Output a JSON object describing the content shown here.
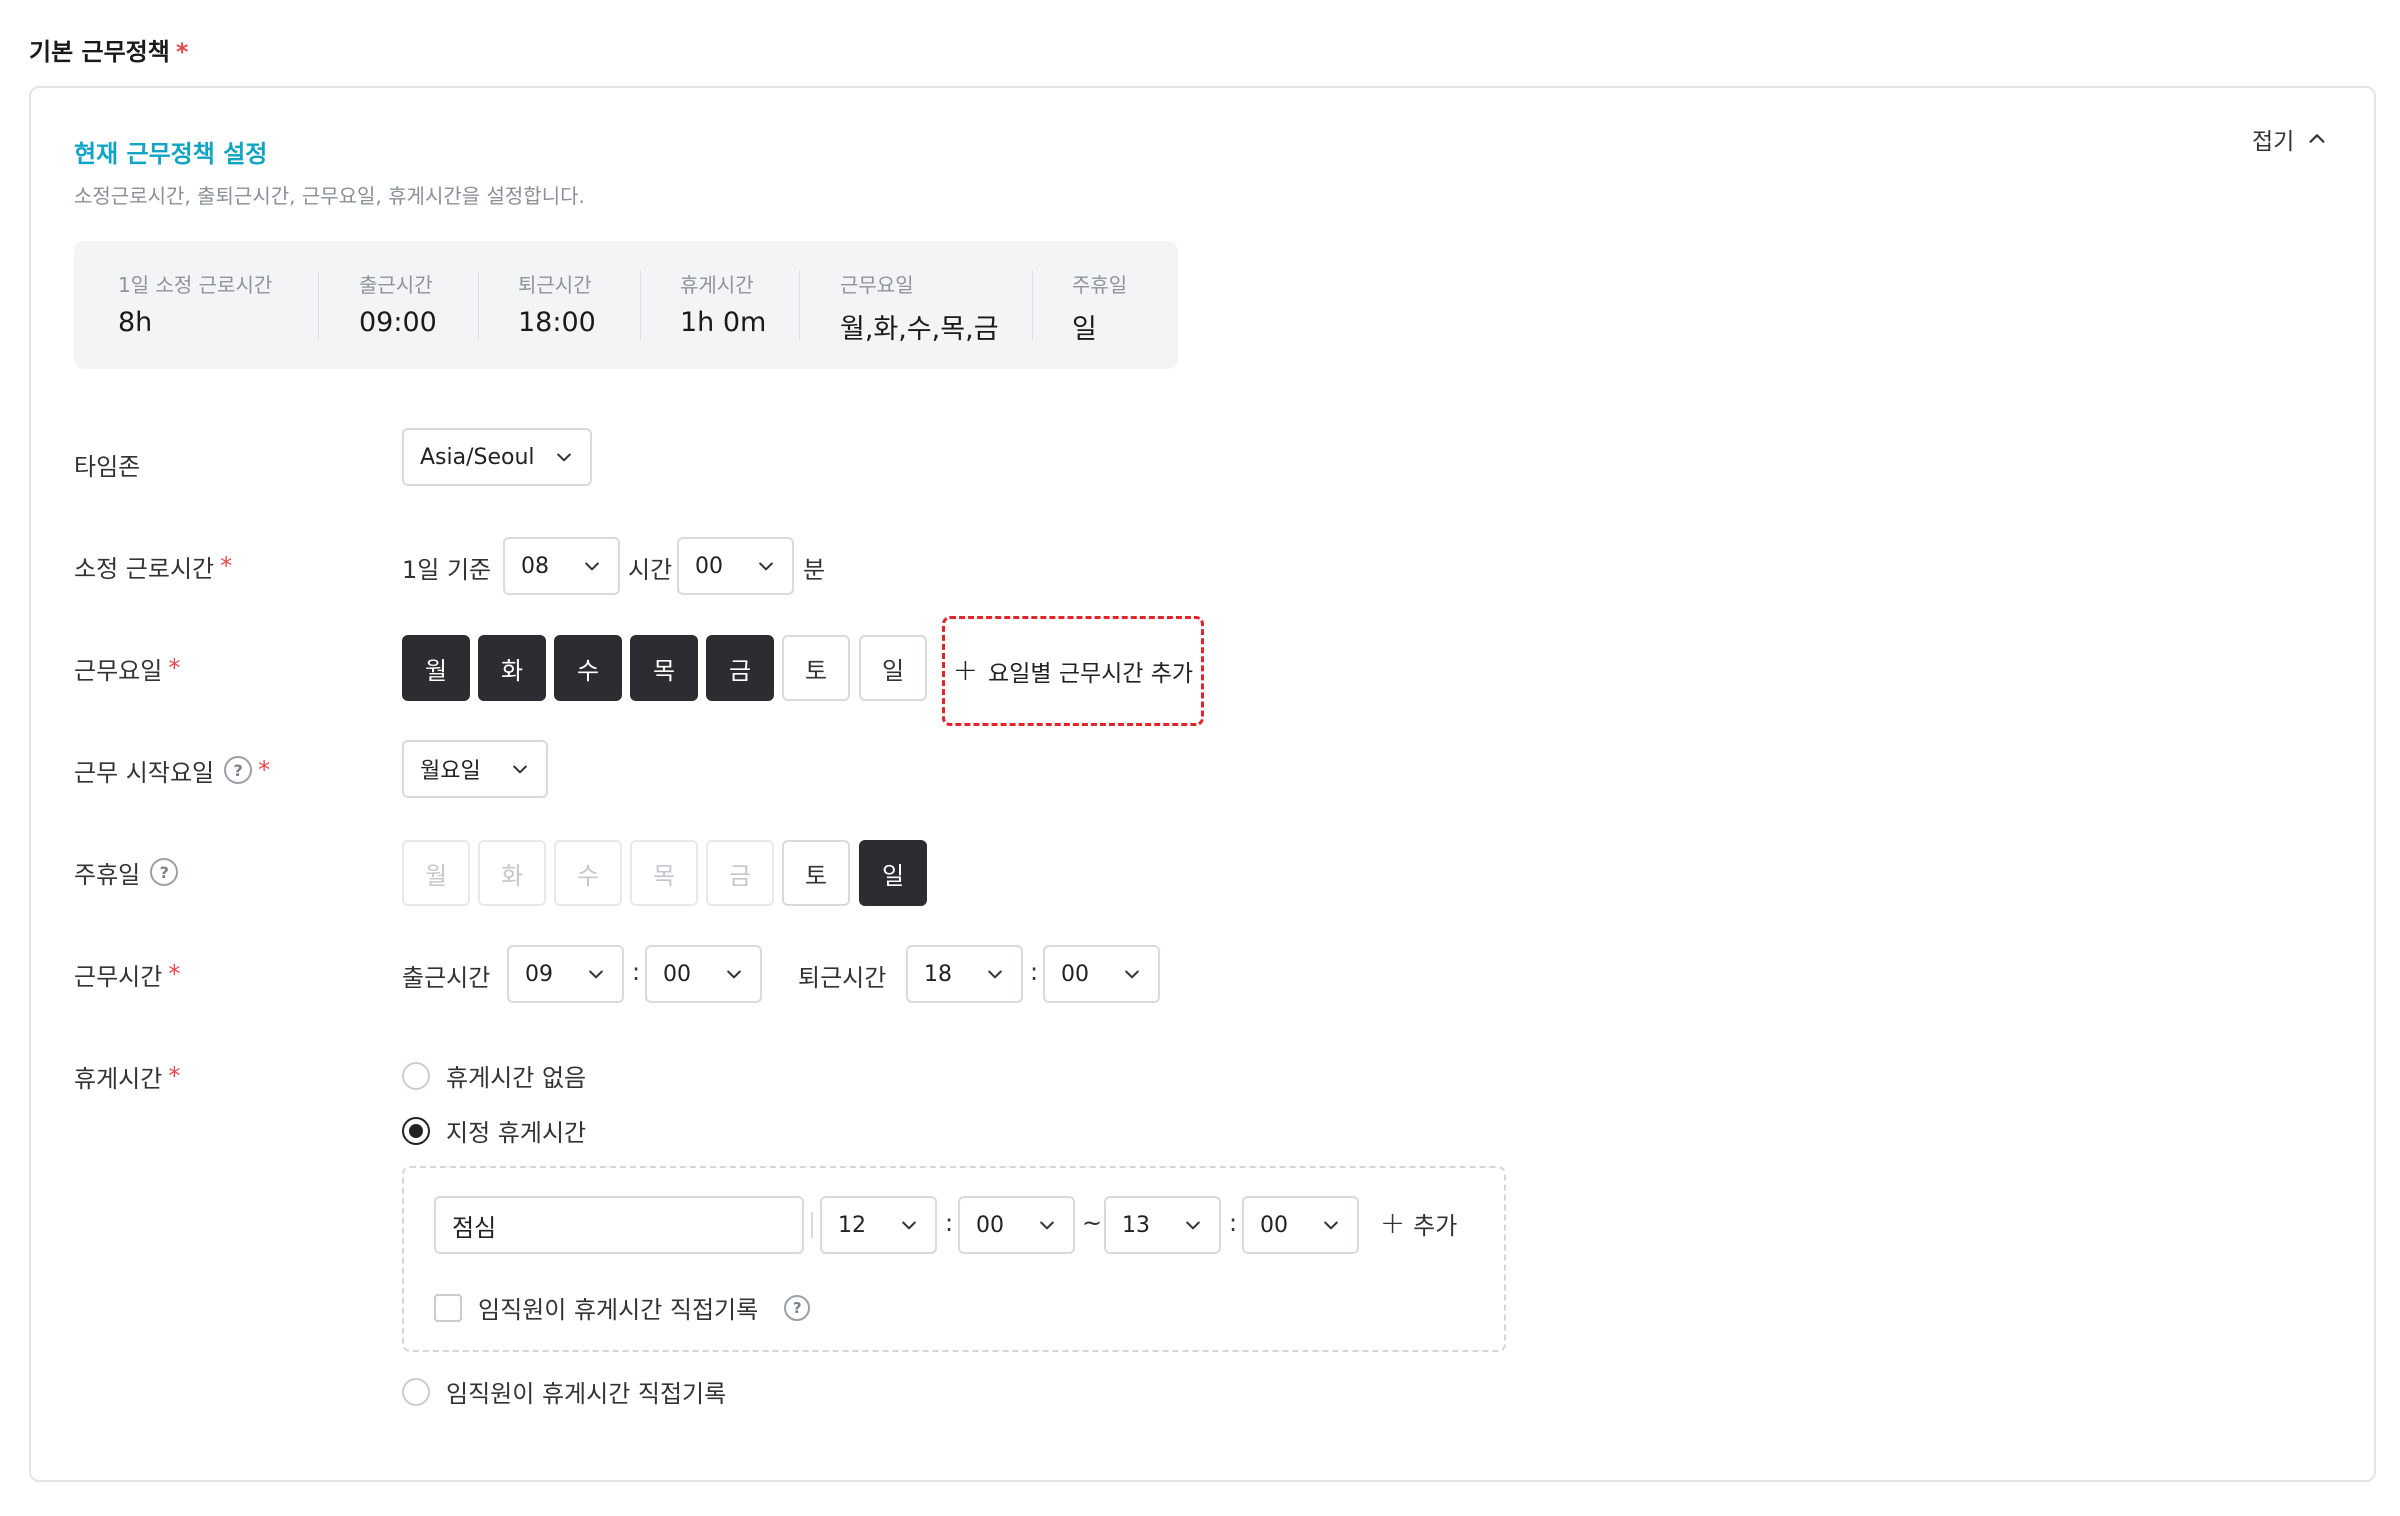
{
  "section_title": "기본 근무정책",
  "required_mark": "*",
  "card": {
    "title": "현재 근무정책 설정",
    "subtitle": "소정근로시간, 출퇴근시간, 근무요일, 휴게시간을 설정합니다.",
    "collapse_label": "접기"
  },
  "summary": [
    {
      "label": "1일 소정 근로시간",
      "value": "8h"
    },
    {
      "label": "출근시간",
      "value": "09:00"
    },
    {
      "label": "퇴근시간",
      "value": "18:00"
    },
    {
      "label": "휴게시간",
      "value": "1h 0m"
    },
    {
      "label": "근무요일",
      "value": "월,화,수,목,금"
    },
    {
      "label": "주휴일",
      "value": "일"
    }
  ],
  "timezone": {
    "label": "타임존",
    "value": "Asia/Seoul"
  },
  "work_hours": {
    "label": "소정 근로시간",
    "prefix": "1일 기준",
    "hour": "08",
    "hour_unit": "시간",
    "minute": "00",
    "minute_unit": "분"
  },
  "work_days": {
    "label": "근무요일",
    "days": [
      "월",
      "화",
      "수",
      "목",
      "금",
      "토",
      "일"
    ],
    "selected": [
      true,
      true,
      true,
      true,
      true,
      false,
      false
    ],
    "add_label": "요일별 근무시간 추가"
  },
  "start_day": {
    "label": "근무 시작요일",
    "value": "월요일"
  },
  "weekly_holiday": {
    "label": "주휴일",
    "days": [
      "월",
      "화",
      "수",
      "목",
      "금",
      "토",
      "일"
    ],
    "state": [
      "disabled",
      "disabled",
      "disabled",
      "disabled",
      "disabled",
      "off",
      "on"
    ]
  },
  "work_time": {
    "label": "근무시간",
    "start_label": "출근시간",
    "start_hour": "09",
    "start_minute": "00",
    "end_label": "퇴근시간",
    "end_hour": "18",
    "end_minute": "00",
    "colon": ":"
  },
  "break_time": {
    "label": "휴게시간",
    "options": [
      "휴게시간 없음",
      "지정 휴게시간",
      "임직원이 휴게시간 직접기록"
    ],
    "selected_index": 1,
    "entry": {
      "name": "점심",
      "start_hour": "12",
      "start_minute": "00",
      "tilde": "~",
      "end_hour": "13",
      "end_minute": "00",
      "add_label": "추가"
    },
    "self_record_checkbox": "임직원이 휴게시간 직접기록"
  }
}
